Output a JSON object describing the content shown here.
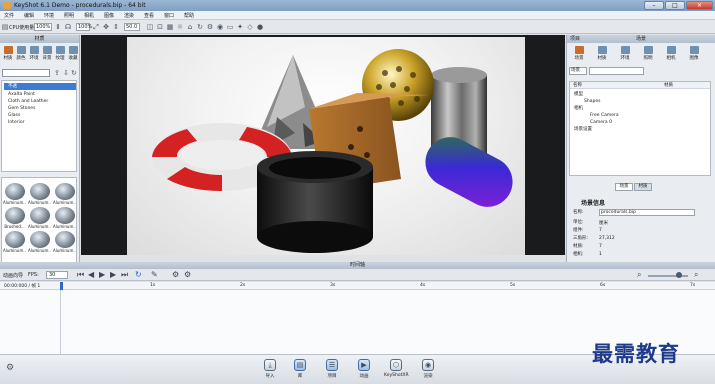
{
  "window": {
    "title": "KeyShot 6.1 Demo - procedurals.bip - 64 bit",
    "min_label": "–",
    "max_label": "□",
    "close_label": "✕"
  },
  "menu": [
    "文件",
    "编辑",
    "环境",
    "照明",
    "相机",
    "图像",
    "渲染",
    "查看",
    "窗口",
    "帮助"
  ],
  "toolbar": {
    "cpu_label": "CPU使用量",
    "cpu_value": "100%",
    "zoom_value": "100%",
    "fov_value": "50.0"
  },
  "library": {
    "title": "材质",
    "tabs": [
      "材质",
      "颜色",
      "环境",
      "背景",
      "纹理",
      "收藏"
    ],
    "tree": [
      "不透",
      "Axalta Paint",
      "Cloth and Leather",
      "Gem Stones",
      "Glass",
      "Interior"
    ],
    "selected_index": 0,
    "thumbs": [
      "Aluminum...",
      "Aluminum...",
      "Aluminum...",
      "Brushed...",
      "Aluminum...",
      "Aluminum...",
      "Aluminum...",
      "Aluminum...",
      "Aluminum..."
    ]
  },
  "project": {
    "title": "项目",
    "panel_title": "场景",
    "tabs": [
      "场景",
      "材质",
      "环境",
      "照明",
      "相机",
      "图像"
    ],
    "subtabs": [
      "场景",
      "材质"
    ],
    "columns": {
      "name": "名称",
      "material": "材质"
    },
    "tree": [
      {
        "label": "模型"
      },
      {
        "label": "Shapes"
      },
      {
        "label": "相机"
      },
      {
        "label": "Free Camera"
      },
      {
        "label": "Camera 0"
      },
      {
        "label": "场景设置"
      }
    ],
    "info_title": "场景信息",
    "info": [
      {
        "k": "名称:",
        "v": "procedurals.bip"
      },
      {
        "k": "单位:",
        "v": "厘米"
      },
      {
        "k": "组件:",
        "v": "7"
      },
      {
        "k": "三角形:",
        "v": "27,312"
      },
      {
        "k": "材质:",
        "v": "7"
      },
      {
        "k": "相机:",
        "v": "1"
      }
    ]
  },
  "timeline": {
    "title": "时间轴",
    "mode_label": "动画向导",
    "fps_label": "FPS:",
    "fps_value": "30",
    "time_label": "00:00:000 / 帧 1",
    "ruler": [
      "1s",
      "2s",
      "3s",
      "4s",
      "5s",
      "6s",
      "7s"
    ]
  },
  "bottom_buttons": [
    {
      "label": "导入",
      "icon": "import-icon",
      "glyph": "⤓"
    },
    {
      "label": "库",
      "icon": "library-icon",
      "glyph": "▤"
    },
    {
      "label": "项目",
      "icon": "project-icon",
      "glyph": "☰"
    },
    {
      "label": "动画",
      "icon": "animation-icon",
      "glyph": "▶"
    },
    {
      "label": "KeyShotXR",
      "icon": "keyshotxr-icon",
      "glyph": "⬡"
    },
    {
      "label": "渲染",
      "icon": "render-icon",
      "glyph": "◉"
    }
  ],
  "watermark": "最需教育",
  "colors": {
    "accent": "#3d7bd6",
    "titlebar": "#8fabcb",
    "selected_tab": "#c96b2c"
  }
}
